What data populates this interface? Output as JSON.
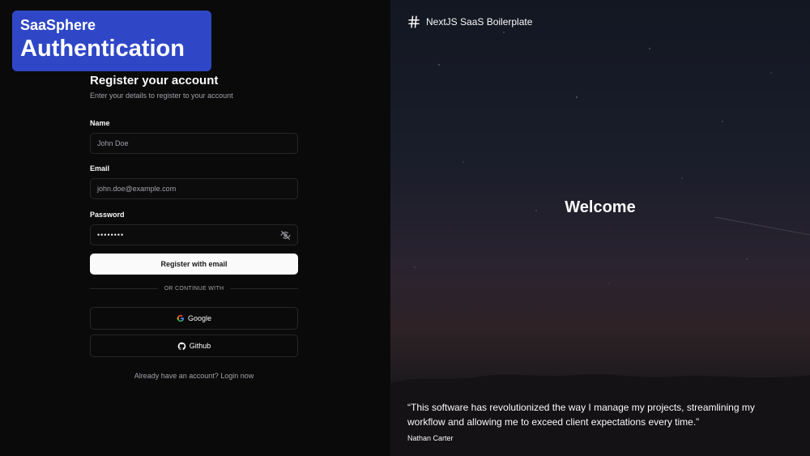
{
  "overlay": {
    "line1": "SaaSphere",
    "line2": "Authentication"
  },
  "form": {
    "title": "Register your account",
    "subtitle": "Enter your details to register to your account",
    "name_label": "Name",
    "name_value": "John Doe",
    "email_label": "Email",
    "email_value": "john.doe@example.com",
    "password_label": "Password",
    "password_value": "••••••••",
    "register_button": "Register with email",
    "divider_text": "OR CONTINUE WITH",
    "google_button": "Google",
    "github_button": "Github",
    "login_prompt": "Already have an account? Login now"
  },
  "hero": {
    "brand": "NextJS SaaS Boilerplate",
    "welcome": "Welcome",
    "quote": "“This software has revolutionized the way I manage my projects, streamlining my workflow and allowing me to exceed client expectations every time.”",
    "author": "Nathan Carter"
  },
  "colors": {
    "accent": "#2f47c7",
    "background": "#0a0a0a",
    "border": "#27272a"
  },
  "icons": {
    "brand": "hash-icon",
    "password_toggle": "eye-off-icon",
    "google": "google-icon",
    "github": "github-icon"
  }
}
